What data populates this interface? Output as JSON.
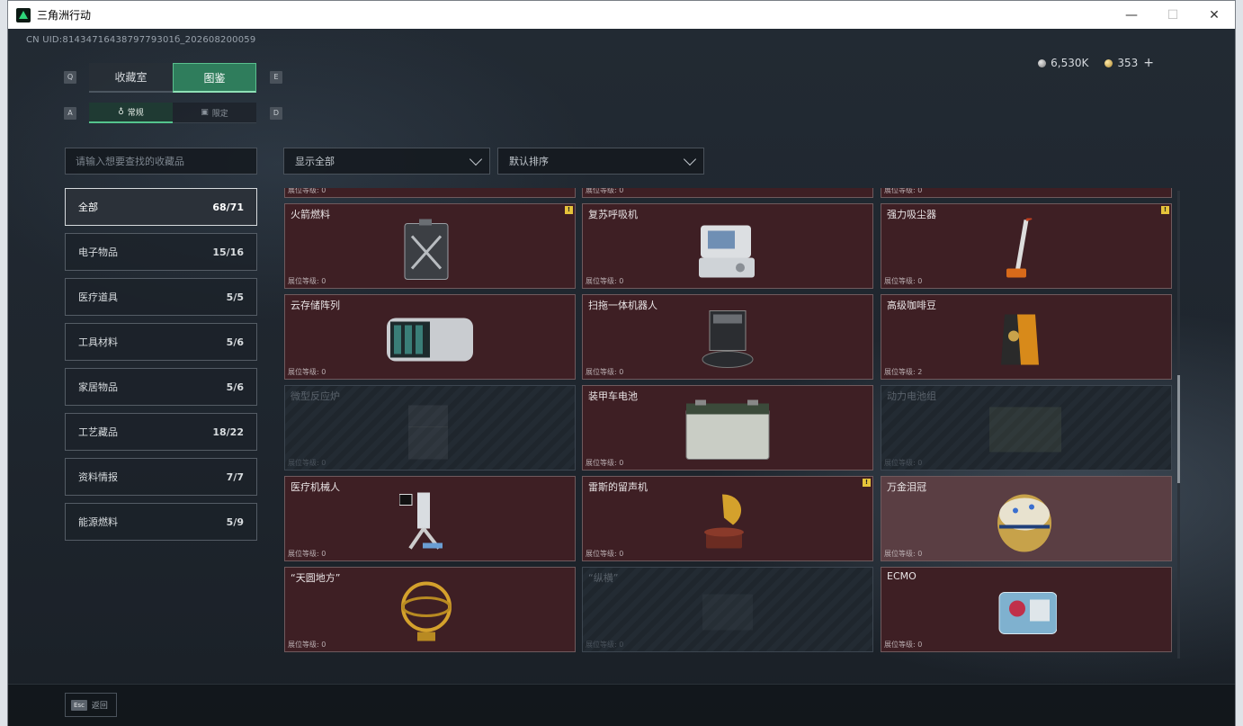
{
  "window": {
    "title": "三角洲行动"
  },
  "header": {
    "uid": "CN UID:8143471643879779301б_202608200059"
  },
  "currency": {
    "silver": "6,530K",
    "gold": "353",
    "plus": "+"
  },
  "keys": {
    "q": "Q",
    "e": "E",
    "a": "A",
    "d": "D"
  },
  "tabs": [
    {
      "label": "收藏室"
    },
    {
      "label": "图鉴"
    }
  ],
  "subtabs": [
    {
      "label": "常规",
      "icon": "♁"
    },
    {
      "label": "限定",
      "icon": "▣"
    }
  ],
  "search": {
    "placeholder": "请输入想要查找的收藏品"
  },
  "filters": {
    "show_all": "显示全部",
    "sort": "默认排序"
  },
  "categories": [
    {
      "label": "全部",
      "count": "68/71"
    },
    {
      "label": "电子物品",
      "count": "15/16"
    },
    {
      "label": "医疗道具",
      "count": "5/5"
    },
    {
      "label": "工具材料",
      "count": "5/6"
    },
    {
      "label": "家居物品",
      "count": "5/6"
    },
    {
      "label": "工艺藏品",
      "count": "18/22"
    },
    {
      "label": "资料情报",
      "count": "7/7"
    },
    {
      "label": "能源燃料",
      "count": "5/9"
    }
  ],
  "level_label": "展位等级: ",
  "cards_top_partial": [
    {
      "level": "0"
    },
    {
      "level": "0"
    },
    {
      "level": "0"
    }
  ],
  "cards": [
    {
      "name": "火箭燃料",
      "level": "0",
      "warn": true,
      "locked": false,
      "icon": "fuel-can-icon"
    },
    {
      "name": "复苏呼吸机",
      "level": "0",
      "warn": false,
      "locked": false,
      "icon": "ventilator-icon"
    },
    {
      "name": "强力吸尘器",
      "level": "0",
      "warn": true,
      "locked": false,
      "icon": "vacuum-icon"
    },
    {
      "name": "云存储阵列",
      "level": "0",
      "warn": false,
      "locked": false,
      "icon": "storage-array-icon"
    },
    {
      "name": "扫拖一体机器人",
      "level": "0",
      "warn": false,
      "locked": false,
      "icon": "robot-vacuum-icon"
    },
    {
      "name": "高级咖啡豆",
      "level": "2",
      "warn": false,
      "locked": false,
      "icon": "coffee-bag-icon"
    },
    {
      "name": "微型反应炉",
      "level": "0",
      "warn": false,
      "locked": true,
      "icon": "reactor-icon"
    },
    {
      "name": "装甲车电池",
      "level": "0",
      "warn": false,
      "locked": false,
      "icon": "battery-icon"
    },
    {
      "name": "动力电池组",
      "level": "0",
      "warn": false,
      "locked": true,
      "icon": "battery-pack-icon"
    },
    {
      "name": "医疗机械人",
      "level": "0",
      "warn": false,
      "locked": false,
      "icon": "medical-robot-icon"
    },
    {
      "name": "雷斯的留声机",
      "level": "0",
      "warn": true,
      "locked": false,
      "icon": "gramophone-icon"
    },
    {
      "name": "万金泪冠",
      "level": "0",
      "warn": false,
      "locked": false,
      "icon": "jeweled-egg-icon"
    },
    {
      "name": "“天圆地方”",
      "level": "0",
      "warn": false,
      "locked": false,
      "icon": "armillary-sphere-icon"
    },
    {
      "name": "“纵横”",
      "level": "0",
      "warn": false,
      "locked": true,
      "icon": "board-icon"
    },
    {
      "name": "ECMO",
      "level": "0",
      "warn": false,
      "locked": false,
      "icon": "ecmo-icon"
    }
  ],
  "warn_mark": "!",
  "footer": {
    "esc": "Esc",
    "back": "返回"
  }
}
